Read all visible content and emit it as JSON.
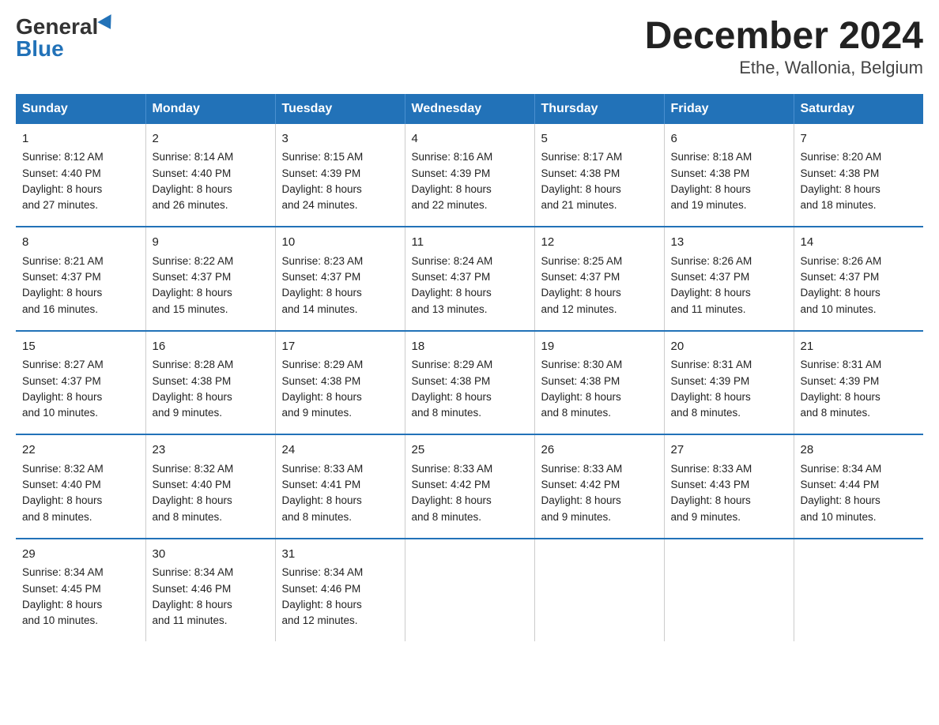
{
  "logo": {
    "general": "General",
    "blue": "Blue"
  },
  "title": "December 2024",
  "subtitle": "Ethe, Wallonia, Belgium",
  "days_header": [
    "Sunday",
    "Monday",
    "Tuesday",
    "Wednesday",
    "Thursday",
    "Friday",
    "Saturday"
  ],
  "weeks": [
    [
      {
        "day": "1",
        "sunrise": "8:12 AM",
        "sunset": "4:40 PM",
        "daylight": "8 hours and 27 minutes."
      },
      {
        "day": "2",
        "sunrise": "8:14 AM",
        "sunset": "4:40 PM",
        "daylight": "8 hours and 26 minutes."
      },
      {
        "day": "3",
        "sunrise": "8:15 AM",
        "sunset": "4:39 PM",
        "daylight": "8 hours and 24 minutes."
      },
      {
        "day": "4",
        "sunrise": "8:16 AM",
        "sunset": "4:39 PM",
        "daylight": "8 hours and 22 minutes."
      },
      {
        "day": "5",
        "sunrise": "8:17 AM",
        "sunset": "4:38 PM",
        "daylight": "8 hours and 21 minutes."
      },
      {
        "day": "6",
        "sunrise": "8:18 AM",
        "sunset": "4:38 PM",
        "daylight": "8 hours and 19 minutes."
      },
      {
        "day": "7",
        "sunrise": "8:20 AM",
        "sunset": "4:38 PM",
        "daylight": "8 hours and 18 minutes."
      }
    ],
    [
      {
        "day": "8",
        "sunrise": "8:21 AM",
        "sunset": "4:37 PM",
        "daylight": "8 hours and 16 minutes."
      },
      {
        "day": "9",
        "sunrise": "8:22 AM",
        "sunset": "4:37 PM",
        "daylight": "8 hours and 15 minutes."
      },
      {
        "day": "10",
        "sunrise": "8:23 AM",
        "sunset": "4:37 PM",
        "daylight": "8 hours and 14 minutes."
      },
      {
        "day": "11",
        "sunrise": "8:24 AM",
        "sunset": "4:37 PM",
        "daylight": "8 hours and 13 minutes."
      },
      {
        "day": "12",
        "sunrise": "8:25 AM",
        "sunset": "4:37 PM",
        "daylight": "8 hours and 12 minutes."
      },
      {
        "day": "13",
        "sunrise": "8:26 AM",
        "sunset": "4:37 PM",
        "daylight": "8 hours and 11 minutes."
      },
      {
        "day": "14",
        "sunrise": "8:26 AM",
        "sunset": "4:37 PM",
        "daylight": "8 hours and 10 minutes."
      }
    ],
    [
      {
        "day": "15",
        "sunrise": "8:27 AM",
        "sunset": "4:37 PM",
        "daylight": "8 hours and 10 minutes."
      },
      {
        "day": "16",
        "sunrise": "8:28 AM",
        "sunset": "4:38 PM",
        "daylight": "8 hours and 9 minutes."
      },
      {
        "day": "17",
        "sunrise": "8:29 AM",
        "sunset": "4:38 PM",
        "daylight": "8 hours and 9 minutes."
      },
      {
        "day": "18",
        "sunrise": "8:29 AM",
        "sunset": "4:38 PM",
        "daylight": "8 hours and 8 minutes."
      },
      {
        "day": "19",
        "sunrise": "8:30 AM",
        "sunset": "4:38 PM",
        "daylight": "8 hours and 8 minutes."
      },
      {
        "day": "20",
        "sunrise": "8:31 AM",
        "sunset": "4:39 PM",
        "daylight": "8 hours and 8 minutes."
      },
      {
        "day": "21",
        "sunrise": "8:31 AM",
        "sunset": "4:39 PM",
        "daylight": "8 hours and 8 minutes."
      }
    ],
    [
      {
        "day": "22",
        "sunrise": "8:32 AM",
        "sunset": "4:40 PM",
        "daylight": "8 hours and 8 minutes."
      },
      {
        "day": "23",
        "sunrise": "8:32 AM",
        "sunset": "4:40 PM",
        "daylight": "8 hours and 8 minutes."
      },
      {
        "day": "24",
        "sunrise": "8:33 AM",
        "sunset": "4:41 PM",
        "daylight": "8 hours and 8 minutes."
      },
      {
        "day": "25",
        "sunrise": "8:33 AM",
        "sunset": "4:42 PM",
        "daylight": "8 hours and 8 minutes."
      },
      {
        "day": "26",
        "sunrise": "8:33 AM",
        "sunset": "4:42 PM",
        "daylight": "8 hours and 9 minutes."
      },
      {
        "day": "27",
        "sunrise": "8:33 AM",
        "sunset": "4:43 PM",
        "daylight": "8 hours and 9 minutes."
      },
      {
        "day": "28",
        "sunrise": "8:34 AM",
        "sunset": "4:44 PM",
        "daylight": "8 hours and 10 minutes."
      }
    ],
    [
      {
        "day": "29",
        "sunrise": "8:34 AM",
        "sunset": "4:45 PM",
        "daylight": "8 hours and 10 minutes."
      },
      {
        "day": "30",
        "sunrise": "8:34 AM",
        "sunset": "4:46 PM",
        "daylight": "8 hours and 11 minutes."
      },
      {
        "day": "31",
        "sunrise": "8:34 AM",
        "sunset": "4:46 PM",
        "daylight": "8 hours and 12 minutes."
      },
      {
        "day": "",
        "sunrise": "",
        "sunset": "",
        "daylight": ""
      },
      {
        "day": "",
        "sunrise": "",
        "sunset": "",
        "daylight": ""
      },
      {
        "day": "",
        "sunrise": "",
        "sunset": "",
        "daylight": ""
      },
      {
        "day": "",
        "sunrise": "",
        "sunset": "",
        "daylight": ""
      }
    ]
  ],
  "labels": {
    "sunrise": "Sunrise:",
    "sunset": "Sunset:",
    "daylight": "Daylight:"
  }
}
